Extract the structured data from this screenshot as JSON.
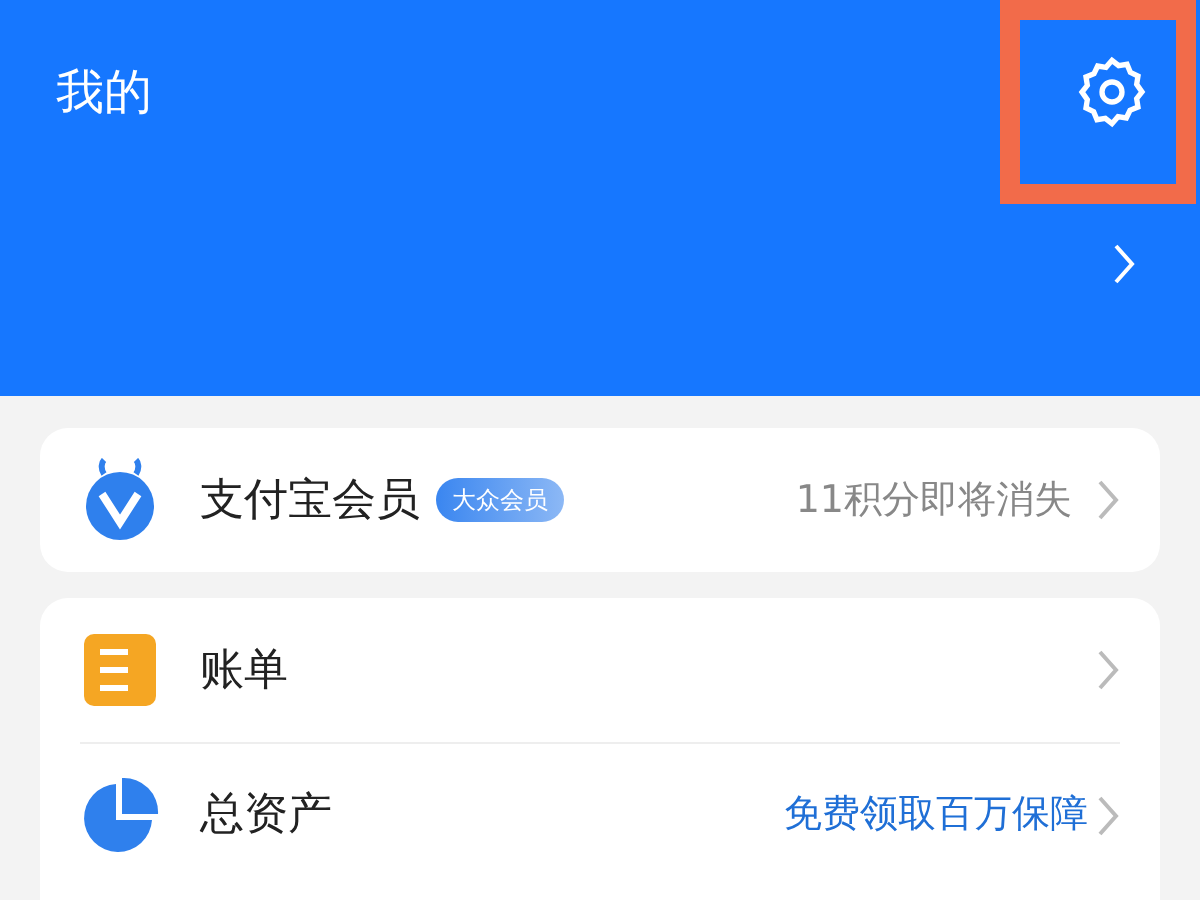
{
  "header": {
    "title": "我的"
  },
  "member": {
    "name": "支付宝会员",
    "badge": "大众会员",
    "note": "11积分即将消失"
  },
  "items": [
    {
      "kind": "bill",
      "label": "账单"
    },
    {
      "kind": "assets",
      "label": "总资产",
      "note": "免费领取百万保障"
    }
  ]
}
